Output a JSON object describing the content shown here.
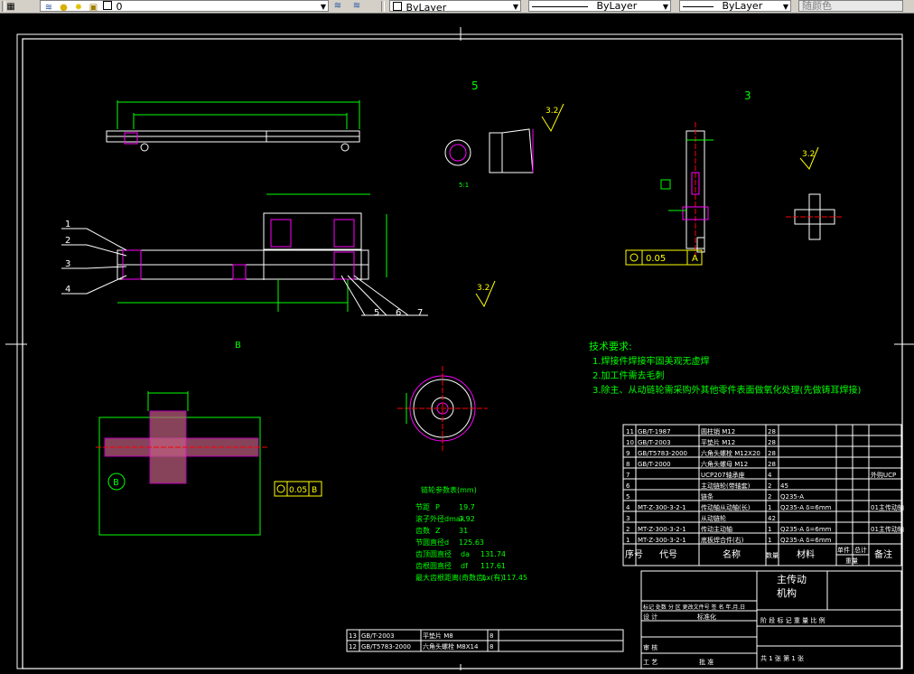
{
  "toolbar": {
    "layer_name": "0",
    "color_value": "ByLayer",
    "linetype_value": "ByLayer",
    "lineweight_value": "ByLayer",
    "plotstyle_value": "随颜色"
  },
  "drawing": {
    "view_labels": {
      "view5": "5",
      "view3": "3",
      "scale_1": "5:1",
      "view_B": "B"
    },
    "roughness": {
      "r1": "3.2",
      "r2": "3.2",
      "r3": "3.2"
    },
    "balloons": [
      "1",
      "2",
      "3",
      "4",
      "5",
      "6",
      "7"
    ],
    "tolerance_A": {
      "value": "0.05",
      "datum": "A"
    },
    "tolerance_B": {
      "value": "0.05",
      "datum": "B"
    },
    "tech_req": {
      "title": "技术要求:",
      "items": [
        "1.焊接件焊接牢固美观无虚焊",
        "2.加工件需去毛刺",
        "3.除主、从动链轮需采购外其他零件表面做氧化处理(先做铸耳焊接)"
      ]
    },
    "params": {
      "title": "链轮参数表(mm)",
      "rows": [
        {
          "label": "节距",
          "sym": "P",
          "val": "19.7"
        },
        {
          "label": "滚子外径dmax",
          "sym": "",
          "val": "7.92"
        },
        {
          "label": "齿数",
          "sym": "Z",
          "val": "31"
        },
        {
          "label": "节圆直径d",
          "sym": "",
          "val": "125.63"
        },
        {
          "label": "齿顶圆直径",
          "sym": "da",
          "val": "131.74"
        },
        {
          "label": "齿根圆直径",
          "sym": "df",
          "val": "117.61"
        },
        {
          "label": "最大齿根距离(奇数齿)",
          "sym": "Lx(有)",
          "val": "117.45"
        }
      ]
    },
    "bom": {
      "rows": [
        {
          "no": "11",
          "code": "GB/T-1987",
          "name": "圆柱销 M12",
          "qty": "28",
          "material": "",
          "note": ""
        },
        {
          "no": "10",
          "code": "GB/T-2003",
          "name": "平垫片 M12",
          "qty": "28",
          "material": "",
          "note": ""
        },
        {
          "no": "9",
          "code": "GB/T5783-2000",
          "name": "六角头螺栓 M12X20",
          "qty": "28",
          "material": "",
          "note": ""
        },
        {
          "no": "8",
          "code": "GB/T-2000",
          "name": "六角头螺母 M12",
          "qty": "28",
          "material": "",
          "note": ""
        },
        {
          "no": "7",
          "code": "",
          "name": "UCP207轴承座",
          "qty": "4",
          "material": "",
          "note": "外购UCP"
        },
        {
          "no": "6",
          "code": "",
          "name": "主动链轮(带轴套)",
          "qty": "2",
          "material": "45",
          "note": ""
        },
        {
          "no": "5",
          "code": "",
          "name": "链条",
          "qty": "2",
          "material": "Q235-A",
          "note": ""
        },
        {
          "no": "4",
          "code": "MT-Z-300-3-2-1",
          "name": "传动轴从动轴(长)",
          "qty": "1",
          "material": "Q235-A δ=6mm",
          "note": "01主传动轴"
        },
        {
          "no": "3",
          "code": "",
          "name": "从动链轮",
          "qty": "42",
          "material": "",
          "note": ""
        },
        {
          "no": "2",
          "code": "MT-Z-300-3-2-1",
          "name": "传动主动轴",
          "qty": "1",
          "material": "Q235-A δ=6mm",
          "note": "01主传动轴"
        },
        {
          "no": "1",
          "code": "MT-Z-300-3-2-1",
          "name": "底板焊合件(右)",
          "qty": "1",
          "material": "Q235-A δ=6mm",
          "note": ""
        }
      ],
      "header": {
        "no": "序号",
        "code": "代号",
        "name": "名称",
        "qty": "数量",
        "material": "材料",
        "single": "单件",
        "total": "总计",
        "weight": "重量",
        "note": "备注"
      }
    },
    "titleblock": {
      "title_line1": "主传动",
      "title_line2": "机构",
      "design": "设 计",
      "standardize": "标准化",
      "review": "审 核",
      "process": "工 艺",
      "approve": "批 准",
      "marks": "标记 处数 分 区 更改文件号 签 名 年.月.日",
      "stage": "阶 段 标 记   重 量   比 例",
      "sheets": "共 1 张   第 1 张"
    },
    "bom_extra": {
      "rows": [
        {
          "no": "13",
          "code": "GB/T-2003",
          "name": "平垫片 M8",
          "qty": "8"
        },
        {
          "no": "12",
          "code": "GB/T5783-2000",
          "name": "六角头螺栓 M8X14",
          "qty": "8"
        }
      ]
    }
  }
}
